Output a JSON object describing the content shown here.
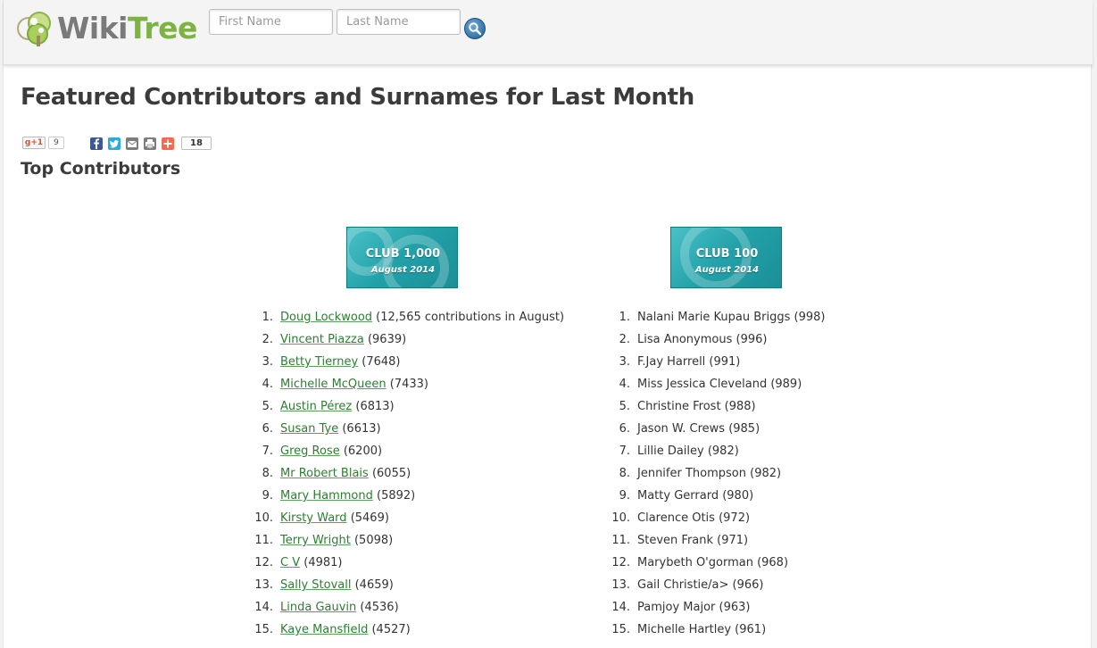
{
  "header": {
    "logo_text_wiki": "Wiki",
    "logo_text_tree": "Tree",
    "first_name_placeholder": "First Name",
    "last_name_placeholder": "Last Name",
    "search_icon": "search-icon"
  },
  "page_title": "Featured Contributors and Surnames for Last Month",
  "share": {
    "gplus_label": "g+1",
    "gplus_count": "9",
    "addthis_count": "18",
    "icons": [
      "facebook-icon",
      "twitter-icon",
      "email-icon",
      "print-icon",
      "addthis-icon"
    ]
  },
  "section_title": "Top Contributors",
  "badges": {
    "club1000": {
      "title": "CLUB 1,000",
      "date": "August 2014"
    },
    "club100": {
      "title": "CLUB 100",
      "date": "August 2014"
    }
  },
  "club1000_list": [
    {
      "num": "1.",
      "name": "Doug Lockwood",
      "count": "(12,565 contributions in August)"
    },
    {
      "num": "2.",
      "name": "Vincent Piazza",
      "count": "(9639)"
    },
    {
      "num": "3.",
      "name": "Betty Tierney",
      "count": "(7648)"
    },
    {
      "num": "4.",
      "name": "Michelle McQueen",
      "count": "(7433)"
    },
    {
      "num": "5.",
      "name": "Austin Pérez",
      "count": "(6813)"
    },
    {
      "num": "6.",
      "name": "Susan Tye",
      "count": "(6613)"
    },
    {
      "num": "7.",
      "name": "Greg Rose",
      "count": "(6200)"
    },
    {
      "num": "8.",
      "name": "Mr Robert Blais",
      "count": "(6055)"
    },
    {
      "num": "9.",
      "name": "Mary Hammond",
      "count": "(5892)"
    },
    {
      "num": "10.",
      "name": "Kirsty Ward",
      "count": "(5469)"
    },
    {
      "num": "11.",
      "name": "Terry Wright",
      "count": "(5098)"
    },
    {
      "num": "12.",
      "name": "C V",
      "count": "(4981)"
    },
    {
      "num": "13.",
      "name": "Sally Stovall",
      "count": "(4659)"
    },
    {
      "num": "14.",
      "name": "Linda Gauvin",
      "count": "(4536)"
    },
    {
      "num": "15.",
      "name": "Kaye Mansfield",
      "count": "(4527)"
    }
  ],
  "club100_list": [
    {
      "num": "1.",
      "text": "Nalani Marie Kupau Briggs (998)"
    },
    {
      "num": "2.",
      "text": "Lisa Anonymous (996)"
    },
    {
      "num": "3.",
      "text": "F.Jay Harrell (991)"
    },
    {
      "num": "4.",
      "text": "Miss Jessica Cleveland (989)"
    },
    {
      "num": "5.",
      "text": "Christine Frost (988)"
    },
    {
      "num": "6.",
      "text": "Jason W. Crews (985)"
    },
    {
      "num": "7.",
      "text": "Lillie Dailey (982)"
    },
    {
      "num": "8.",
      "text": "Jennifer Thompson (982)"
    },
    {
      "num": "9.",
      "text": "Matty Gerrard (980)"
    },
    {
      "num": "10.",
      "text": "Clarence Otis (972)"
    },
    {
      "num": "11.",
      "text": "Steven Frank (971)"
    },
    {
      "num": "12.",
      "text": "Marybeth O'gorman (968)"
    },
    {
      "num": "13.",
      "text": "Gail Christie/a> (966)"
    },
    {
      "num": "14.",
      "text": "Pamjoy Major (963)"
    },
    {
      "num": "15.",
      "text": "Michelle Hartley (961)"
    }
  ]
}
